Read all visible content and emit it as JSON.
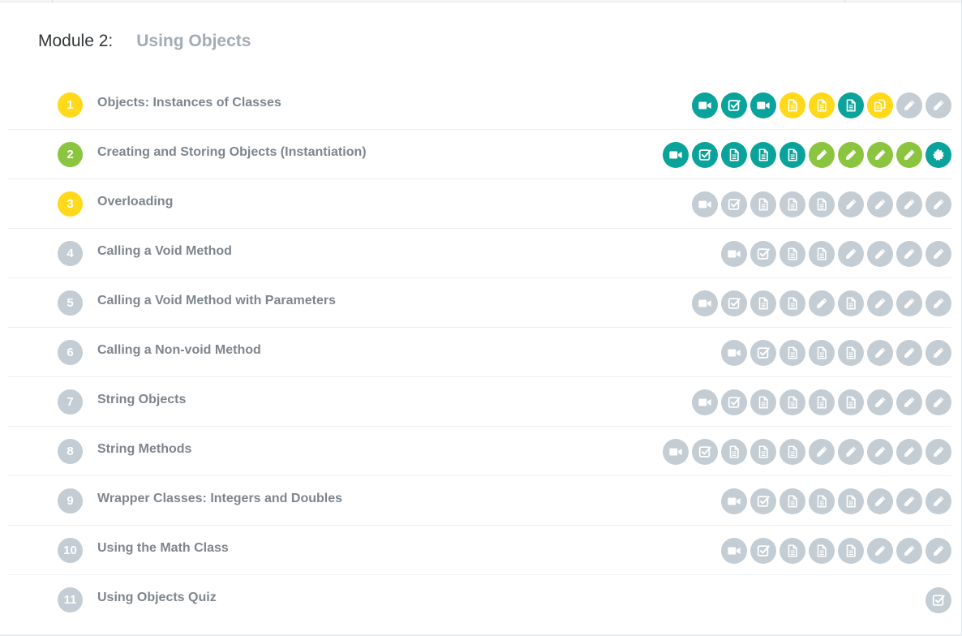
{
  "module": {
    "label": "Module 2:",
    "name": "Using Objects"
  },
  "colors": {
    "teal": "#0aa39b",
    "yellow": "#ffd91a",
    "green": "#8bc53f",
    "grey": "#c3cdd3",
    "title_text": "#7d868c",
    "module_name": "#a3acb3"
  },
  "lessons": [
    {
      "number": "1",
      "title": "Objects: Instances of Classes",
      "status": "yellow",
      "activities": [
        {
          "icon": "video-icon",
          "color": "teal"
        },
        {
          "icon": "checkbox-icon",
          "color": "teal"
        },
        {
          "icon": "video-icon",
          "color": "teal"
        },
        {
          "icon": "document-icon",
          "color": "yellow"
        },
        {
          "icon": "document-icon",
          "color": "yellow"
        },
        {
          "icon": "document-icon",
          "color": "teal"
        },
        {
          "icon": "copy-documents-icon",
          "color": "yellow"
        },
        {
          "icon": "pencil-icon",
          "color": "grey"
        },
        {
          "icon": "pencil-icon",
          "color": "grey"
        }
      ]
    },
    {
      "number": "2",
      "title": "Creating and Storing Objects (Instantiation)",
      "status": "green",
      "activities": [
        {
          "icon": "video-icon",
          "color": "teal"
        },
        {
          "icon": "checkbox-icon",
          "color": "teal"
        },
        {
          "icon": "document-icon",
          "color": "teal"
        },
        {
          "icon": "document-icon",
          "color": "teal"
        },
        {
          "icon": "document-icon",
          "color": "teal"
        },
        {
          "icon": "pencil-icon",
          "color": "green"
        },
        {
          "icon": "pencil-icon",
          "color": "green"
        },
        {
          "icon": "pencil-icon",
          "color": "green"
        },
        {
          "icon": "pencil-icon",
          "color": "green"
        },
        {
          "icon": "badge-icon",
          "color": "teal"
        }
      ]
    },
    {
      "number": "3",
      "title": "Overloading",
      "status": "yellow",
      "activities": [
        {
          "icon": "video-icon",
          "color": "grey"
        },
        {
          "icon": "checkbox-icon",
          "color": "grey"
        },
        {
          "icon": "document-icon",
          "color": "grey"
        },
        {
          "icon": "document-icon",
          "color": "grey"
        },
        {
          "icon": "document-icon",
          "color": "grey"
        },
        {
          "icon": "pencil-icon",
          "color": "grey"
        },
        {
          "icon": "pencil-icon",
          "color": "grey"
        },
        {
          "icon": "pencil-icon",
          "color": "grey"
        },
        {
          "icon": "pencil-icon",
          "color": "grey"
        }
      ]
    },
    {
      "number": "4",
      "title": "Calling a Void Method",
      "status": "grey",
      "activities": [
        {
          "icon": "video-icon",
          "color": "grey"
        },
        {
          "icon": "checkbox-icon",
          "color": "grey"
        },
        {
          "icon": "document-icon",
          "color": "grey"
        },
        {
          "icon": "document-icon",
          "color": "grey"
        },
        {
          "icon": "pencil-icon",
          "color": "grey"
        },
        {
          "icon": "pencil-icon",
          "color": "grey"
        },
        {
          "icon": "pencil-icon",
          "color": "grey"
        },
        {
          "icon": "pencil-icon",
          "color": "grey"
        }
      ]
    },
    {
      "number": "5",
      "title": "Calling a Void Method with Parameters",
      "status": "grey",
      "activities": [
        {
          "icon": "video-icon",
          "color": "grey"
        },
        {
          "icon": "checkbox-icon",
          "color": "grey"
        },
        {
          "icon": "document-icon",
          "color": "grey"
        },
        {
          "icon": "document-icon",
          "color": "grey"
        },
        {
          "icon": "pencil-icon",
          "color": "grey"
        },
        {
          "icon": "document-icon",
          "color": "grey"
        },
        {
          "icon": "pencil-icon",
          "color": "grey"
        },
        {
          "icon": "pencil-icon",
          "color": "grey"
        },
        {
          "icon": "pencil-icon",
          "color": "grey"
        }
      ]
    },
    {
      "number": "6",
      "title": "Calling a Non-void Method",
      "status": "grey",
      "activities": [
        {
          "icon": "video-icon",
          "color": "grey"
        },
        {
          "icon": "checkbox-icon",
          "color": "grey"
        },
        {
          "icon": "document-icon",
          "color": "grey"
        },
        {
          "icon": "document-icon",
          "color": "grey"
        },
        {
          "icon": "document-icon",
          "color": "grey"
        },
        {
          "icon": "pencil-icon",
          "color": "grey"
        },
        {
          "icon": "pencil-icon",
          "color": "grey"
        },
        {
          "icon": "pencil-icon",
          "color": "grey"
        }
      ]
    },
    {
      "number": "7",
      "title": "String Objects",
      "status": "grey",
      "activities": [
        {
          "icon": "video-icon",
          "color": "grey"
        },
        {
          "icon": "checkbox-icon",
          "color": "grey"
        },
        {
          "icon": "document-icon",
          "color": "grey"
        },
        {
          "icon": "document-icon",
          "color": "grey"
        },
        {
          "icon": "document-icon",
          "color": "grey"
        },
        {
          "icon": "document-icon",
          "color": "grey"
        },
        {
          "icon": "pencil-icon",
          "color": "grey"
        },
        {
          "icon": "pencil-icon",
          "color": "grey"
        },
        {
          "icon": "pencil-icon",
          "color": "grey"
        }
      ]
    },
    {
      "number": "8",
      "title": "String Methods",
      "status": "grey",
      "activities": [
        {
          "icon": "video-icon",
          "color": "grey"
        },
        {
          "icon": "checkbox-icon",
          "color": "grey"
        },
        {
          "icon": "document-icon",
          "color": "grey"
        },
        {
          "icon": "document-icon",
          "color": "grey"
        },
        {
          "icon": "document-icon",
          "color": "grey"
        },
        {
          "icon": "pencil-icon",
          "color": "grey"
        },
        {
          "icon": "pencil-icon",
          "color": "grey"
        },
        {
          "icon": "pencil-icon",
          "color": "grey"
        },
        {
          "icon": "pencil-icon",
          "color": "grey"
        },
        {
          "icon": "pencil-icon",
          "color": "grey"
        }
      ]
    },
    {
      "number": "9",
      "title": "Wrapper Classes: Integers and Doubles",
      "status": "grey",
      "activities": [
        {
          "icon": "video-icon",
          "color": "grey"
        },
        {
          "icon": "checkbox-icon",
          "color": "grey"
        },
        {
          "icon": "document-icon",
          "color": "grey"
        },
        {
          "icon": "document-icon",
          "color": "grey"
        },
        {
          "icon": "document-icon",
          "color": "grey"
        },
        {
          "icon": "pencil-icon",
          "color": "grey"
        },
        {
          "icon": "pencil-icon",
          "color": "grey"
        },
        {
          "icon": "pencil-icon",
          "color": "grey"
        }
      ]
    },
    {
      "number": "10",
      "title": "Using the Math Class",
      "status": "grey",
      "activities": [
        {
          "icon": "video-icon",
          "color": "grey"
        },
        {
          "icon": "checkbox-icon",
          "color": "grey"
        },
        {
          "icon": "document-icon",
          "color": "grey"
        },
        {
          "icon": "document-icon",
          "color": "grey"
        },
        {
          "icon": "document-icon",
          "color": "grey"
        },
        {
          "icon": "pencil-icon",
          "color": "grey"
        },
        {
          "icon": "pencil-icon",
          "color": "grey"
        },
        {
          "icon": "pencil-icon",
          "color": "grey"
        }
      ]
    },
    {
      "number": "11",
      "title": "Using Objects Quiz",
      "status": "grey",
      "activities": [
        {
          "icon": "checkbox-icon",
          "color": "grey"
        }
      ]
    }
  ]
}
